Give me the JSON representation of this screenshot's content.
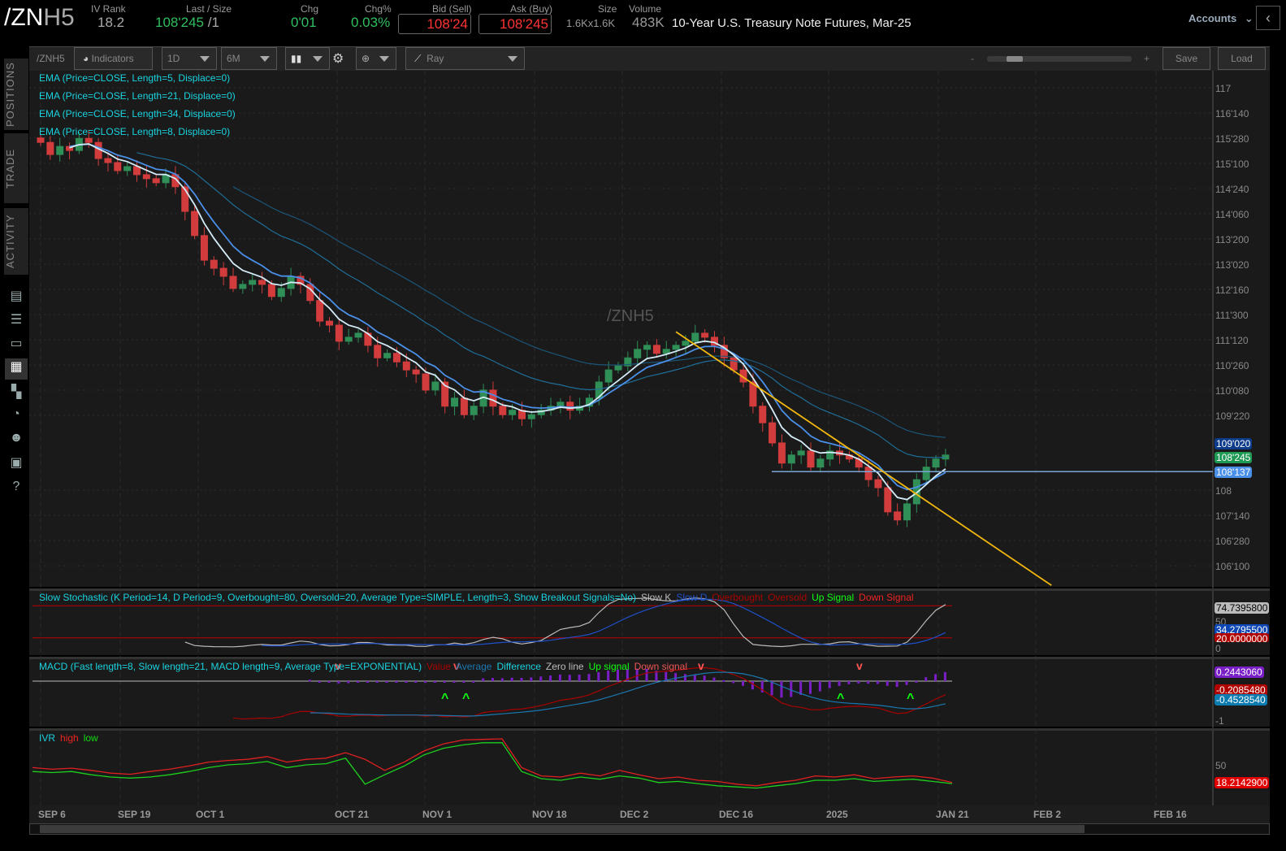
{
  "header": {
    "symbol_prefix": "/ZN",
    "symbol_suffix": "H5",
    "iv_rank_label": "IV Rank",
    "iv_rank": "18.2",
    "last_label": "Last / Size",
    "last": "108'245",
    "last_size": "/1",
    "chg_label": "Chg",
    "chg": "0'01",
    "chgpct_label": "Chg%",
    "chgpct": "0.03%",
    "bid_label": "Bid (Sell)",
    "bid": "108'24",
    "ask_label": "Ask (Buy)",
    "ask": "108'245",
    "size_label": "Size",
    "size": "1.6Kx1.6K",
    "volume_label": "Volume",
    "volume": "483K",
    "description": "10-Year U.S. Treasury Note Futures, Mar-25",
    "accounts": "Accounts"
  },
  "sidebar": {
    "tabs": [
      "POSITIONS",
      "TRADE",
      "ACTIVITY"
    ]
  },
  "toolbar": {
    "symbol": "/ZNH5",
    "indicators": "Indicators",
    "aggregation": "1D",
    "timeframe": "6M",
    "drawing_tool": "Ray",
    "zoom_minus": "-",
    "zoom_plus": "+",
    "save": "Save",
    "load": "Load",
    "zoom_level": 0.15
  },
  "chart": {
    "watermark": "/ZNH5",
    "studies": [
      "EMA (Price=CLOSE, Length=5, Displace=0)",
      "EMA (Price=CLOSE, Length=21, Displace=0)",
      "EMA (Price=CLOSE, Length=34, Displace=0)",
      "EMA (Price=CLOSE, Length=8, Displace=0)"
    ],
    "y_ticks": [
      "117",
      "116'140",
      "115'280",
      "115'100",
      "114'240",
      "114'060",
      "113'200",
      "113'020",
      "112'160",
      "111'300",
      "111'120",
      "110'260",
      "110'080",
      "109'220",
      "108",
      "107'140",
      "106'280",
      "106'100"
    ],
    "price_tags": {
      "ema_high": "109'020",
      "last": "108'245",
      "line": "108'137"
    },
    "x_labels": [
      "SEP 6",
      "SEP 19",
      "OCT 1",
      "OCT 21",
      "NOV 1",
      "NOV 18",
      "DEC 2",
      "DEC 16",
      "2025",
      "JAN 21",
      "FEB 2",
      "FEB 16"
    ]
  },
  "chart_data": {
    "type": "candlestick",
    "title": "/ZNH5",
    "closes": [
      115.78,
      115.51,
      115.69,
      115.6,
      115.87,
      115.78,
      115.42,
      115.33,
      115.15,
      115.24,
      115.06,
      114.97,
      114.88,
      115.06,
      114.79,
      114.24,
      113.7,
      113.15,
      112.97,
      112.79,
      112.52,
      112.61,
      112.7,
      112.61,
      112.34,
      112.52,
      112.79,
      112.61,
      112.25,
      111.79,
      111.7,
      111.34,
      111.43,
      111.52,
      111.25,
      110.97,
      111.07,
      110.88,
      110.7,
      110.61,
      110.25,
      110.43,
      109.89,
      110.07,
      109.7,
      109.89,
      110.25,
      109.89,
      109.7,
      109.8,
      109.61,
      109.7,
      109.8,
      109.89,
      109.98,
      109.8,
      109.89,
      110.07,
      110.43,
      110.7,
      110.79,
      110.97,
      111.16,
      111.25,
      111.07,
      111.16,
      111.25,
      111.34,
      111.52,
      111.43,
      111.25,
      110.97,
      110.7,
      110.43,
      109.89,
      109.52,
      109.07,
      108.62,
      108.8,
      108.89,
      108.53,
      108.71,
      108.89,
      108.8,
      108.71,
      108.53,
      108.25,
      108.07,
      107.53,
      107.35,
      107.71,
      108.25,
      108.53,
      108.71,
      108.8
    ],
    "horizontal_line": 108.43,
    "trendline": {
      "start": {
        "bar": 66,
        "price": 111.55
      },
      "end": {
        "bar": 105,
        "price": 105.89
      }
    },
    "y_range": [
      105.9,
      117.2
    ]
  },
  "stoch": {
    "legend": "Slow Stochastic (K Period=14, D Period=9, Overbought=80, Oversold=20, Average Type=SIMPLE, Length=3, Show Breakout Signals=No)",
    "slow_k": "Slow K",
    "slow_d": "Slow D",
    "overbought": "Overbought",
    "oversold": "Oversold",
    "up": "Up Signal",
    "down": "Down Signal",
    "ticks": [
      "50",
      "0"
    ],
    "tags": [
      "74.7395800",
      "34.2795500",
      "20.0000000"
    ]
  },
  "macd": {
    "legend": "MACD (Fast length=8, Slow length=21, MACD length=9, Average Type=EXPONENTIAL)",
    "value": "Value",
    "average": "Average",
    "difference": "Difference",
    "zero": "Zero line",
    "up": "Up signal",
    "down": "Down signal",
    "ticks": [
      "-1"
    ],
    "tags": [
      "0.2443060",
      "-0.2085480",
      "-0.4528540"
    ]
  },
  "ivr": {
    "legend": "IVR",
    "high": "high",
    "low": "low",
    "ticks": [
      "50"
    ],
    "tag": "18.2142900",
    "high_values": [
      45,
      42,
      44,
      40,
      35,
      33,
      38,
      42,
      48,
      55,
      58,
      60,
      65,
      55,
      60,
      62,
      72,
      60,
      40,
      55,
      75,
      88,
      95,
      96,
      97,
      45,
      30,
      28,
      35,
      30,
      40,
      32,
      25,
      28,
      22,
      20,
      15,
      12,
      18,
      22,
      30,
      28,
      32,
      25,
      28,
      30,
      26,
      18
    ],
    "low_values": [
      38,
      36,
      38,
      32,
      28,
      26,
      28,
      32,
      38,
      45,
      50,
      52,
      56,
      45,
      50,
      52,
      62,
      15,
      32,
      48,
      68,
      80,
      86,
      90,
      90,
      38,
      25,
      22,
      28,
      24,
      30,
      26,
      18,
      20,
      16,
      12,
      10,
      8,
      12,
      16,
      22,
      22,
      25,
      20,
      22,
      24,
      20,
      16
    ]
  },
  "colors": {
    "up": "#2f8f57",
    "down": "#d23c3c",
    "ema5": "#d4ecf7",
    "ema8": "#4a8fe8",
    "ema21": "#1f6e98",
    "ema34": "#1b567a",
    "accent": "#19d3df"
  }
}
